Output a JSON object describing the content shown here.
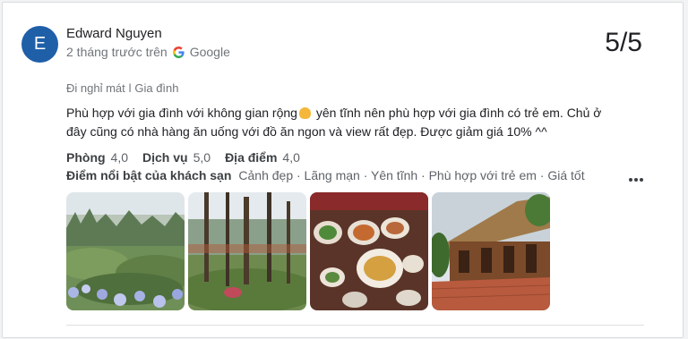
{
  "review": {
    "avatar_letter": "E",
    "reviewer_name": "Edward Nguyen",
    "time": "2 tháng trước trên",
    "source": "Google",
    "score": "5/5",
    "trip_type": "Đi nghỉ mát ǀ Gia đình",
    "text_part1": "Phù hợp với gia đình với không gian rộng",
    "text_part2": " yên tĩnh nên phù hợp với gia đình có trẻ em. Chủ ở đây cũng có nhà hàng ăn uống với đồ ăn ngon và view rất đẹp. Được giảm giá 10% ^^",
    "ratings": [
      {
        "label": "Phòng",
        "value": "4,0"
      },
      {
        "label": "Dịch vụ",
        "value": "5,0"
      },
      {
        "label": "Địa điểm",
        "value": "4,0"
      }
    ],
    "highlights_label": "Điểm nổi bật của khách sạn",
    "highlights_value": "Cảnh đẹp · Lãng mạn · Yên tĩnh · Phù hợp với trẻ em · Giá tốt",
    "photos": [
      {
        "icon": "garden-hydrangea-photo"
      },
      {
        "icon": "pine-forest-photo"
      },
      {
        "icon": "food-table-photo"
      },
      {
        "icon": "wooden-building-photo"
      }
    ]
  },
  "colors": {
    "avatar_bg": "#1f5fa8",
    "secondary_text": "#70757a"
  }
}
